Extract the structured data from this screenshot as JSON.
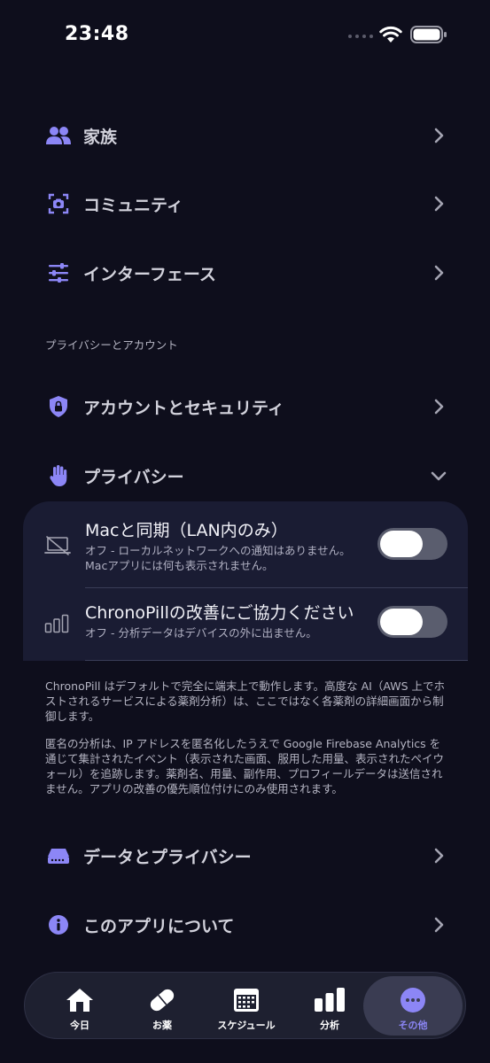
{
  "status_bar": {
    "time": "23:48"
  },
  "menu": {
    "family": "家族",
    "community": "コミュニティ",
    "interface": "インターフェース",
    "section_privacy_account": "プライバシーとアカウント",
    "account_security": "アカウントとセキュリティ",
    "privacy": "プライバシー",
    "data_privacy": "データとプライバシー",
    "about": "このアプリについて"
  },
  "privacy_panel": {
    "mac_sync": {
      "title": "Macと同期（LAN内のみ）",
      "subtitle_1": "オフ - ローカルネットワークへの通知はありません。",
      "subtitle_2": "Macアプリには何も表示されません。",
      "enabled": false
    },
    "improve": {
      "title": "ChronoPillの改善にご協力ください",
      "subtitle": "オフ - 分析データはデバイスの外に出ません。",
      "enabled": false
    }
  },
  "notes": {
    "paragraph_1": "ChronoPill はデフォルトで完全に端末上で動作します。高度な AI（AWS 上でホストされるサービスによる薬剤分析）は、ここではなく各薬剤の詳細画面から制御します。",
    "paragraph_2": "匿名の分析は、IP アドレスを匿名化したうえで Google Firebase Analytics を通じて集計されたイベント（表示された画面、服用した用量、表示されたペイウォール）を追跡します。薬剤名、用量、副作用、プロフィールデータは送信されません。アプリの改善の優先順位付けにのみ使用されます。"
  },
  "tabs": [
    {
      "label": "今日",
      "icon": "house-icon",
      "active": false
    },
    {
      "label": "お薬",
      "icon": "pill-icon",
      "active": false
    },
    {
      "label": "スケジュール",
      "icon": "calendar-icon",
      "active": false
    },
    {
      "label": "分析",
      "icon": "bar-chart-icon",
      "active": false
    },
    {
      "label": "その他",
      "icon": "more-icon",
      "active": true
    }
  ],
  "colors": {
    "accent": "#8c86f6",
    "background": "#0e0e1c",
    "panel": "#1a1c33"
  }
}
